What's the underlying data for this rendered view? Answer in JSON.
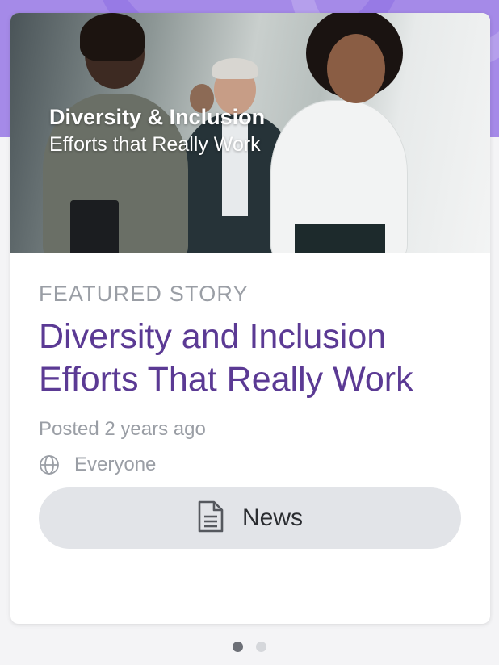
{
  "hero": {
    "line1": "Diversity & Inclusion",
    "line2": "Efforts that Really Work"
  },
  "story": {
    "eyebrow": "FEATURED STORY",
    "headline": "Diversity and Inclusion Efforts That Really Work",
    "posted": "Posted 2 years ago",
    "audience": "Everyone",
    "audience_icon": "globe-icon",
    "type_label": "News",
    "type_icon": "document-icon"
  },
  "carousel": {
    "pages": 2,
    "active_index": 0
  },
  "colors": {
    "headline": "#5b3a94",
    "band": "#a58ae8",
    "pill": "#e2e4e8"
  }
}
